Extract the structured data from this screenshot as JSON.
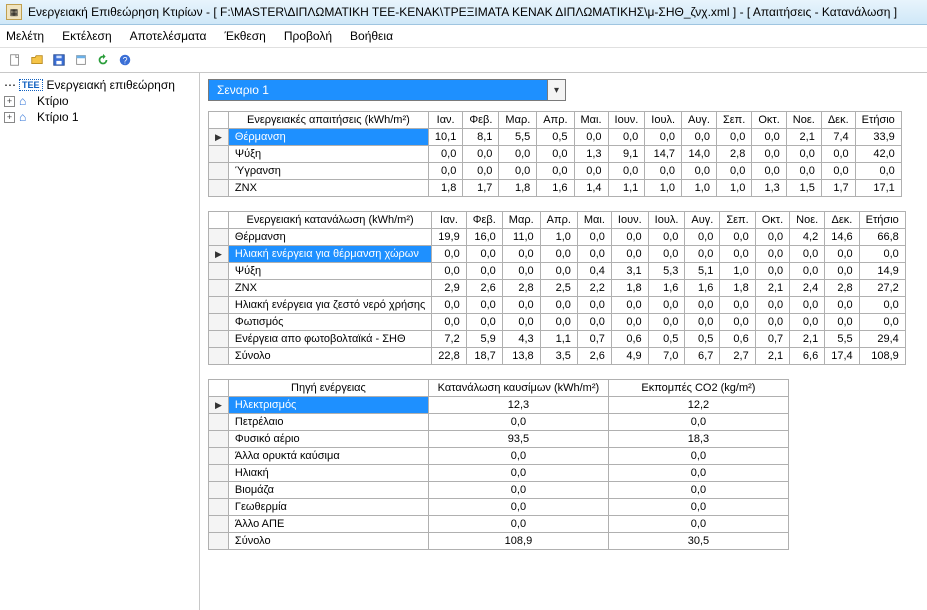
{
  "window": {
    "title": "Ενεργειακή Επιθεώρηση Κτιρίων - [ F:\\MASTER\\ΔΙΠΛΩΜΑΤΙΚΗ ΤΕΕ-ΚΕΝΑΚ\\ΤΡΕΞΙΜΑΤΑ ΚΕΝΑΚ ΔΙΠΛΩΜΑΤΙΚΗΣ\\μ-ΣΗΘ_ζνχ.xml ] - [ Απαιτήσεις - Κατανάλωση ]"
  },
  "menu": {
    "items": [
      "Μελέτη",
      "Εκτέλεση",
      "Αποτελέσματα",
      "Έκθεση",
      "Προβολή",
      "Βοήθεια"
    ]
  },
  "tree": {
    "items": [
      {
        "label": "Ενεργειακή επιθεώρηση",
        "icon": "tee"
      },
      {
        "label": "Κτίριο",
        "icon": "house",
        "expandable": true
      },
      {
        "label": "Κτίριο 1",
        "icon": "house",
        "expandable": true
      }
    ]
  },
  "scenario": {
    "selected": "Σεναριο 1"
  },
  "months": [
    "Ιαν.",
    "Φεβ.",
    "Μαρ.",
    "Απρ.",
    "Μαι.",
    "Ιουν.",
    "Ιουλ.",
    "Αυγ.",
    "Σεπ.",
    "Οκτ.",
    "Νοε.",
    "Δεκ.",
    "Ετήσιο"
  ],
  "table1": {
    "title": "Ενεργειακές απαιτήσεις (kWh/m²)",
    "active_row": 0,
    "rows": [
      {
        "label": "Θέρμανση",
        "highlight": true,
        "values": [
          "10,1",
          "8,1",
          "5,5",
          "0,5",
          "0,0",
          "0,0",
          "0,0",
          "0,0",
          "0,0",
          "0,0",
          "2,1",
          "7,4",
          "33,9"
        ]
      },
      {
        "label": "Ψύξη",
        "values": [
          "0,0",
          "0,0",
          "0,0",
          "0,0",
          "1,3",
          "9,1",
          "14,7",
          "14,0",
          "2,8",
          "0,0",
          "0,0",
          "0,0",
          "42,0"
        ]
      },
      {
        "label": "Ύγρανση",
        "values": [
          "0,0",
          "0,0",
          "0,0",
          "0,0",
          "0,0",
          "0,0",
          "0,0",
          "0,0",
          "0,0",
          "0,0",
          "0,0",
          "0,0",
          "0,0"
        ]
      },
      {
        "label": "ΖΝΧ",
        "values": [
          "1,8",
          "1,7",
          "1,8",
          "1,6",
          "1,4",
          "1,1",
          "1,0",
          "1,0",
          "1,0",
          "1,3",
          "1,5",
          "1,7",
          "17,1"
        ]
      }
    ]
  },
  "table2": {
    "title": "Ενεργειακή κατανάλωση (kWh/m²)",
    "active_row": 1,
    "rows": [
      {
        "label": "Θέρμανση",
        "values": [
          "19,9",
          "16,0",
          "11,0",
          "1,0",
          "0,0",
          "0,0",
          "0,0",
          "0,0",
          "0,0",
          "0,0",
          "4,2",
          "14,6",
          "66,8"
        ]
      },
      {
        "label": "Ηλιακή ενέργεια για θέρμανση χώρων",
        "highlight": true,
        "values": [
          "0,0",
          "0,0",
          "0,0",
          "0,0",
          "0,0",
          "0,0",
          "0,0",
          "0,0",
          "0,0",
          "0,0",
          "0,0",
          "0,0",
          "0,0"
        ]
      },
      {
        "label": "Ψύξη",
        "values": [
          "0,0",
          "0,0",
          "0,0",
          "0,0",
          "0,4",
          "3,1",
          "5,3",
          "5,1",
          "1,0",
          "0,0",
          "0,0",
          "0,0",
          "14,9"
        ]
      },
      {
        "label": "ΖΝΧ",
        "values": [
          "2,9",
          "2,6",
          "2,8",
          "2,5",
          "2,2",
          "1,8",
          "1,6",
          "1,6",
          "1,8",
          "2,1",
          "2,4",
          "2,8",
          "27,2"
        ]
      },
      {
        "label": "Ηλιακή ενέργεια για ζεστό νερό χρήσης",
        "values": [
          "0,0",
          "0,0",
          "0,0",
          "0,0",
          "0,0",
          "0,0",
          "0,0",
          "0,0",
          "0,0",
          "0,0",
          "0,0",
          "0,0",
          "0,0"
        ]
      },
      {
        "label": "Φωτισμός",
        "values": [
          "0,0",
          "0,0",
          "0,0",
          "0,0",
          "0,0",
          "0,0",
          "0,0",
          "0,0",
          "0,0",
          "0,0",
          "0,0",
          "0,0",
          "0,0"
        ]
      },
      {
        "label": "Ενέργεια απο φωτοβολταϊκά - ΣΗΘ",
        "values": [
          "7,2",
          "5,9",
          "4,3",
          "1,1",
          "0,7",
          "0,6",
          "0,5",
          "0,5",
          "0,6",
          "0,7",
          "2,1",
          "5,5",
          "29,4"
        ]
      },
      {
        "label": "Σύνολο",
        "values": [
          "22,8",
          "18,7",
          "13,8",
          "3,5",
          "2,6",
          "4,9",
          "7,0",
          "6,7",
          "2,7",
          "2,1",
          "6,6",
          "17,4",
          "108,9"
        ]
      }
    ]
  },
  "table3": {
    "headers": [
      "Πηγή ενέργειας",
      "Κατανάλωση καυσίμων (kWh/m²)",
      "Εκπομπές CO2 (kg/m²)"
    ],
    "active_row": 0,
    "rows": [
      {
        "label": "Ηλεκτρισμός",
        "highlight": true,
        "values": [
          "12,3",
          "12,2"
        ]
      },
      {
        "label": "Πετρέλαιο",
        "values": [
          "0,0",
          "0,0"
        ]
      },
      {
        "label": "Φυσικό αέριο",
        "values": [
          "93,5",
          "18,3"
        ]
      },
      {
        "label": "Άλλα ορυκτά καύσιμα",
        "values": [
          "0,0",
          "0,0"
        ]
      },
      {
        "label": "Ηλιακή",
        "values": [
          "0,0",
          "0,0"
        ]
      },
      {
        "label": "Βιομάζα",
        "values": [
          "0,0",
          "0,0"
        ]
      },
      {
        "label": "Γεωθερμία",
        "values": [
          "0,0",
          "0,0"
        ]
      },
      {
        "label": "Άλλο ΑΠΕ",
        "values": [
          "0,0",
          "0,0"
        ]
      },
      {
        "label": "Σύνολο",
        "values": [
          "108,9",
          "30,5"
        ]
      }
    ]
  }
}
